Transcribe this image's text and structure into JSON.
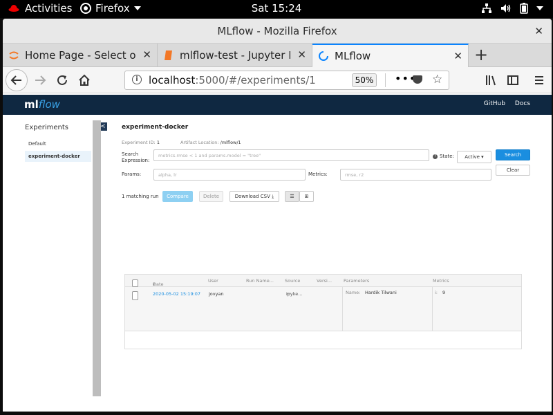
{
  "topbar": {
    "activities": "Activities",
    "app": "Firefox",
    "clock": "Sat 15:24"
  },
  "window": {
    "title": "MLflow - Mozilla Firefox"
  },
  "tabs": [
    {
      "label": "Home Page - Select or cr"
    },
    {
      "label": "mlflow-test - Jupyter Not"
    },
    {
      "label": "MLflow"
    }
  ],
  "navbar": {
    "url_host": "localhost",
    "url_rest": ":5000/#/experiments/1",
    "zoom": "50%"
  },
  "mlflow": {
    "logo_ml": "ml",
    "logo_flow": "flow",
    "links": [
      "GitHub",
      "Docs"
    ],
    "sidebar": {
      "heading": "Experiments",
      "collapse": "<",
      "items": [
        "Default",
        "experiment-docker"
      ]
    },
    "experiment": {
      "title": "experiment-docker",
      "id_label": "Experiment ID:",
      "id_value": "1",
      "artifact_label": "Artifact Location:",
      "artifact_value": "/mlflow/1"
    },
    "search": {
      "label_line1": "Search",
      "label_line2": "Expression:",
      "placeholder": "metrics.rmse < 1 and params.model = \"tree\"",
      "state_label": "State:",
      "state_value": "Active",
      "search_button": "Search",
      "clear_button": "Clear",
      "params_label": "Params:",
      "params_placeholder": "alpha, lr",
      "metrics_label": "Metrics:",
      "metrics_placeholder": "rmse, r2"
    },
    "toolbar": {
      "matching": "1 matching run",
      "compare": "Compare",
      "delete": "Delete",
      "download": "Download CSV"
    },
    "table": {
      "headers": {
        "date": "Date",
        "user": "User",
        "run_name": "Run Name...",
        "source": "Source",
        "version": "Versi...",
        "parameters": "Parameters",
        "metrics": "Metrics"
      },
      "rows": [
        {
          "date": "2020-05-02 15:19:07",
          "user": "jovyan",
          "source": "ipyke...",
          "param_name": "Name:",
          "param_value": "Hardik Tilwani",
          "metric_key": "i:",
          "metric_value": "9"
        }
      ]
    }
  }
}
